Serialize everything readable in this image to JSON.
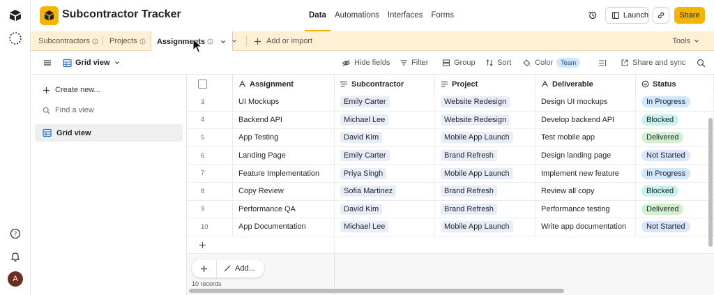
{
  "base": {
    "title": "Subcontractor Tracker",
    "icon": "cube-icon",
    "accent": "#f5b400"
  },
  "topnav": {
    "tabs": [
      {
        "label": "Data",
        "active": true
      },
      {
        "label": "Automations",
        "active": false
      },
      {
        "label": "Interfaces",
        "active": false
      },
      {
        "label": "Forms",
        "active": false
      }
    ],
    "launch_label": "Launch",
    "share_label": "Share"
  },
  "tables": {
    "tabs": [
      {
        "label": "Subcontractors",
        "active": false
      },
      {
        "label": "Projects",
        "active": false
      },
      {
        "label": "Assignments",
        "active": true
      }
    ],
    "add_label": "Add or import",
    "tools_label": "Tools"
  },
  "viewbar": {
    "view_name": "Grid view",
    "hide_fields": "Hide fields",
    "filter": "Filter",
    "group": "Group",
    "sort": "Sort",
    "color": "Color",
    "team_badge": "Team",
    "share_sync": "Share and sync"
  },
  "sidebar": {
    "create_new": "Create new...",
    "find_view": "Find a view",
    "items": [
      {
        "label": "Grid view",
        "selected": true
      }
    ]
  },
  "grid": {
    "columns": [
      {
        "label": "Assignment",
        "icon": "text-field-icon"
      },
      {
        "label": "Subcontractor",
        "icon": "link-field-icon"
      },
      {
        "label": "Project",
        "icon": "link-field-icon"
      },
      {
        "label": "Deliverable",
        "icon": "text-field-icon"
      },
      {
        "label": "Status",
        "icon": "status-field-icon"
      }
    ],
    "rows": [
      {
        "num": "3",
        "assignment": "UI Mockups",
        "subcontractor": "Emily Carter",
        "project": "Website Redesign",
        "deliverable": "Design UI mockups",
        "status": "In Progress"
      },
      {
        "num": "4",
        "assignment": "Backend API",
        "subcontractor": "Michael Lee",
        "project": "Website Redesign",
        "deliverable": "Develop backend API",
        "status": "Blocked"
      },
      {
        "num": "5",
        "assignment": "App Testing",
        "subcontractor": "David Kim",
        "project": "Mobile App Launch",
        "deliverable": "Test mobile app",
        "status": "Delivered"
      },
      {
        "num": "6",
        "assignment": "Landing Page",
        "subcontractor": "Emily Carter",
        "project": "Brand Refresh",
        "deliverable": "Design landing page",
        "status": "Not Started"
      },
      {
        "num": "7",
        "assignment": "Feature Implementation",
        "subcontractor": "Priya Singh",
        "project": "Mobile App Launch",
        "deliverable": "Implement new feature",
        "status": "In Progress"
      },
      {
        "num": "8",
        "assignment": "Copy Review",
        "subcontractor": "Sofia Martinez",
        "project": "Brand Refresh",
        "deliverable": "Review all copy",
        "status": "Blocked"
      },
      {
        "num": "9",
        "assignment": "Performance QA",
        "subcontractor": "David Kim",
        "project": "Brand Refresh",
        "deliverable": "Performance testing",
        "status": "Delivered"
      },
      {
        "num": "10",
        "assignment": "App Documentation",
        "subcontractor": "Michael Lee",
        "project": "Mobile App Launch",
        "deliverable": "Write app documentation",
        "status": "Not Started"
      }
    ],
    "status_colors": {
      "In Progress": "#cfe8fb",
      "Blocked": "#c9f1ee",
      "Delivered": "#d2f2cf",
      "Not Started": "#d9e6fb"
    },
    "add_label": "Add...",
    "records_label": "10 records"
  },
  "rail": {
    "avatar_initial": "A"
  }
}
